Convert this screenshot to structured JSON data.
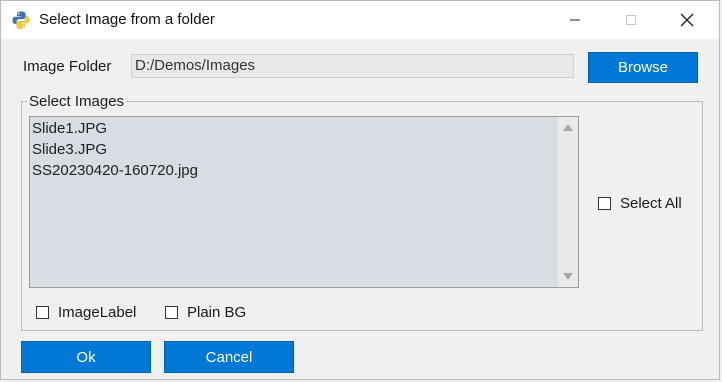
{
  "window": {
    "title": "Select Image from a folder",
    "minimize_glyph": "—",
    "maximize_glyph": "☐",
    "close_glyph": "✕"
  },
  "folder": {
    "label": "Image Folder",
    "value": "D:/Demos/Images",
    "browse_label": "Browse"
  },
  "images_group": {
    "legend": "Select Images",
    "items": [
      "Slide1.JPG",
      "Slide3.JPG",
      "SS20230420-160720.jpg"
    ],
    "select_all_label": "Select All",
    "select_all_checked": false
  },
  "options": {
    "image_label": "ImageLabel",
    "image_label_checked": false,
    "plain_bg": "Plain BG",
    "plain_bg_checked": false
  },
  "actions": {
    "ok_label": "Ok",
    "cancel_label": "Cancel"
  },
  "colors": {
    "accent": "#0078d7",
    "list_background": "#d8dde4"
  }
}
